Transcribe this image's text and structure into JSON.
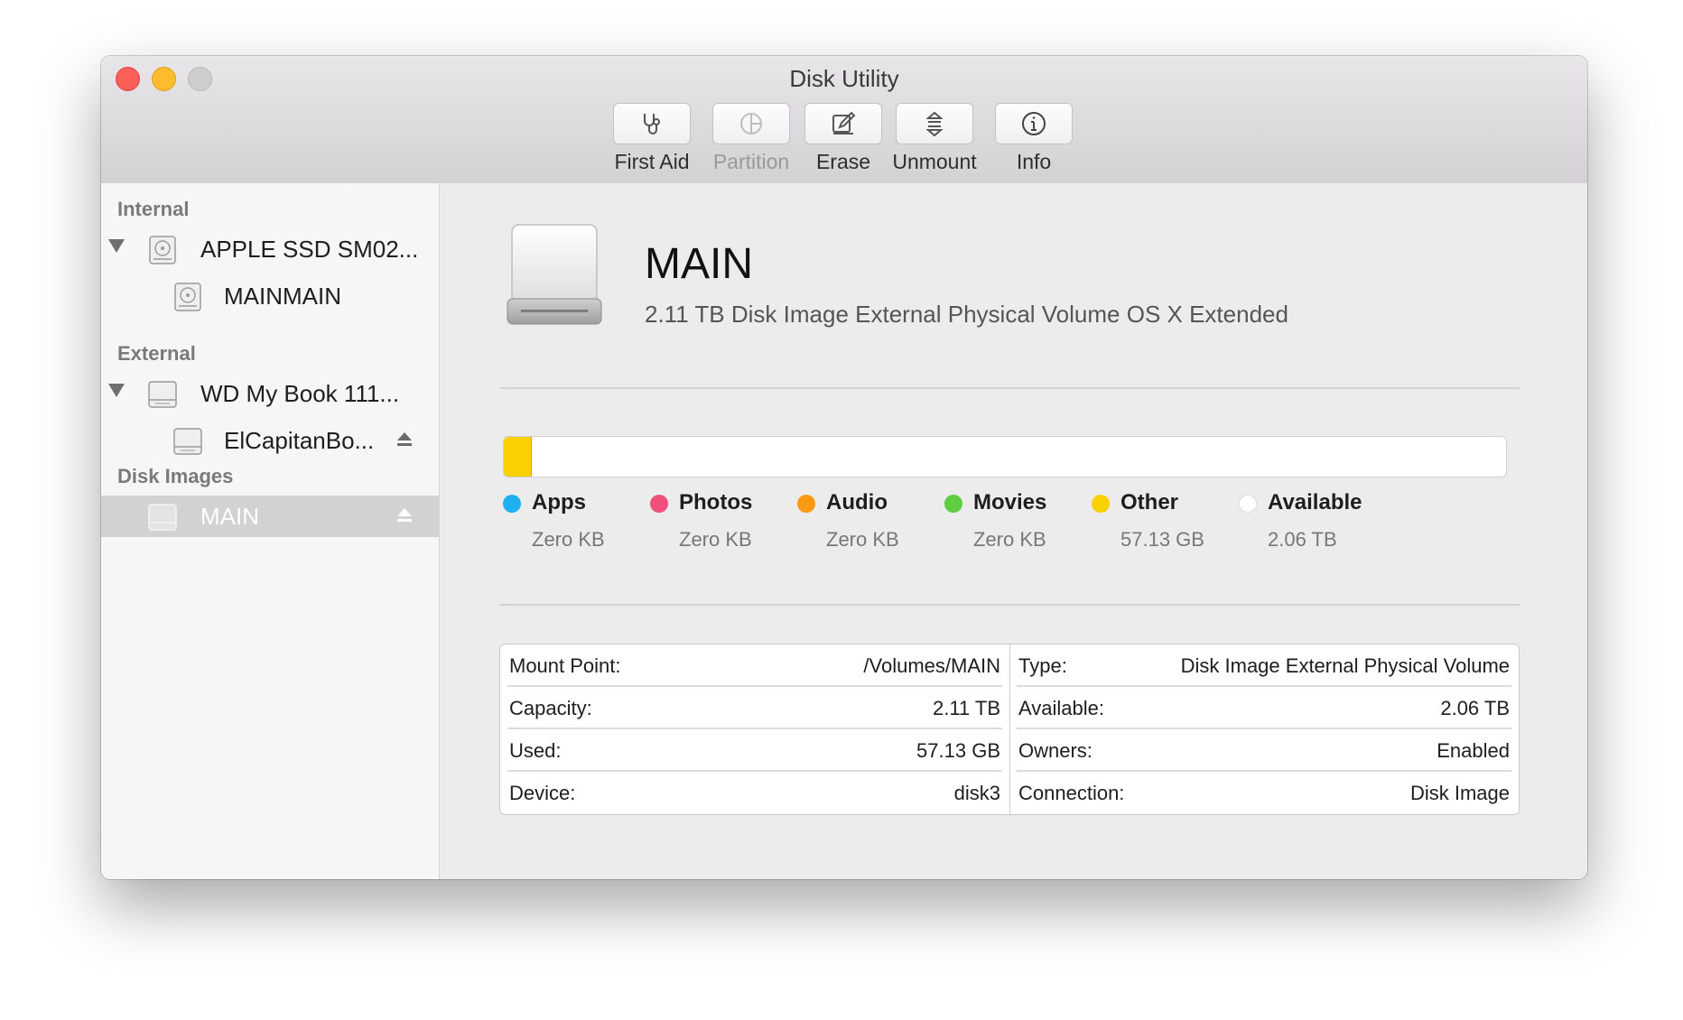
{
  "window": {
    "title": "Disk Utility"
  },
  "toolbar": {
    "first_aid": "First Aid",
    "partition": "Partition",
    "erase": "Erase",
    "unmount": "Unmount",
    "info": "Info"
  },
  "sidebar": {
    "sections": {
      "internal": "Internal",
      "external": "External",
      "disk_images": "Disk Images"
    },
    "items": [
      {
        "label": "APPLE SSD SM02..."
      },
      {
        "label": "MAINMAIN"
      },
      {
        "label": "WD My Book 111..."
      },
      {
        "label": "ElCapitanBo..."
      },
      {
        "label": "MAIN"
      }
    ]
  },
  "volume": {
    "name": "MAIN",
    "description": "2.11 TB Disk Image External Physical Volume OS X Extended"
  },
  "usage": {
    "used_fraction": 0.027,
    "legend": [
      {
        "name": "Apps",
        "value": "Zero KB",
        "color": "#1fb0f2"
      },
      {
        "name": "Photos",
        "value": "Zero KB",
        "color": "#f2507c"
      },
      {
        "name": "Audio",
        "value": "Zero KB",
        "color": "#fb9a12"
      },
      {
        "name": "Movies",
        "value": "Zero KB",
        "color": "#5fcd43"
      },
      {
        "name": "Other",
        "value": "57.13 GB",
        "color": "#fbd000"
      },
      {
        "name": "Available",
        "value": "2.06 TB",
        "color": "#ffffff"
      }
    ]
  },
  "info": {
    "left": [
      {
        "label": "Mount Point:",
        "value": "/Volumes/MAIN"
      },
      {
        "label": "Capacity:",
        "value": "2.11 TB"
      },
      {
        "label": "Used:",
        "value": "57.13 GB"
      },
      {
        "label": "Device:",
        "value": "disk3"
      }
    ],
    "right": [
      {
        "label": "Type:",
        "value": "Disk Image External Physical Volume"
      },
      {
        "label": "Available:",
        "value": "2.06 TB"
      },
      {
        "label": "Owners:",
        "value": "Enabled"
      },
      {
        "label": "Connection:",
        "value": "Disk Image"
      }
    ]
  }
}
